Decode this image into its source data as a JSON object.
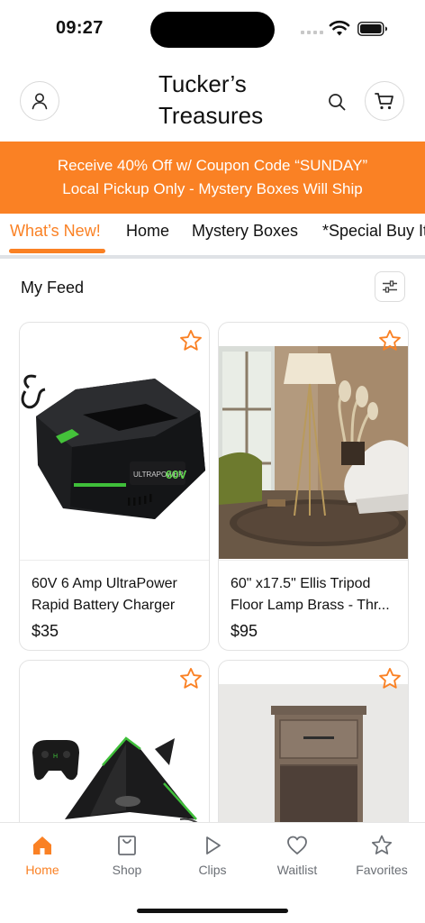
{
  "status_bar": {
    "time": "09:27"
  },
  "header": {
    "store_name_line1": "Tucker’s",
    "store_name_line2": "Treasures",
    "account_icon": "user-icon",
    "search_icon": "search-icon",
    "cart_icon": "cart-icon"
  },
  "promo": {
    "line1": "Receive 40% Off w/ Coupon Code “SUNDAY”",
    "line2": "Local Pickup Only - Mystery Boxes Will Ship",
    "background": "#fa8124"
  },
  "tabs": [
    {
      "label": "What’s New!",
      "active": true
    },
    {
      "label": "Home",
      "active": false
    },
    {
      "label": "Mystery Boxes",
      "active": false
    },
    {
      "label": "*Special Buy It",
      "active": false
    }
  ],
  "feed": {
    "title": "My Feed",
    "filter_icon": "sliders-icon"
  },
  "products": [
    {
      "name_line1": "60V 6 Amp UltraPower",
      "name_line2": "Rapid Battery Charger",
      "price": "$35",
      "image": "battery-charger-image",
      "charger_brand": "ULTRAPOWER",
      "charger_badge": "60V"
    },
    {
      "name_line1": "60\" x17.5\" Ellis Tripod",
      "name_line2": "Floor Lamp Brass - Thr...",
      "price": "$95",
      "image": "living-room-floor-lamp-image"
    },
    {
      "name_line1": "",
      "name_line2": "",
      "price": "",
      "image": "rc-glider-plane-image"
    },
    {
      "name_line1": "",
      "name_line2": "",
      "price": "",
      "image": "wood-nightstand-image"
    }
  ],
  "bottom_nav": [
    {
      "label": "Home",
      "icon": "home-icon",
      "active": true
    },
    {
      "label": "Shop",
      "icon": "shopping-bag-icon",
      "active": false
    },
    {
      "label": "Clips",
      "icon": "play-icon",
      "active": false
    },
    {
      "label": "Waitlist",
      "icon": "heart-icon",
      "active": false
    },
    {
      "label": "Favorites",
      "icon": "star-icon",
      "active": false
    }
  ],
  "colors": {
    "accent": "#fa8124",
    "inactive_nav": "#6b6f75",
    "divider": "#dfe2e6"
  }
}
